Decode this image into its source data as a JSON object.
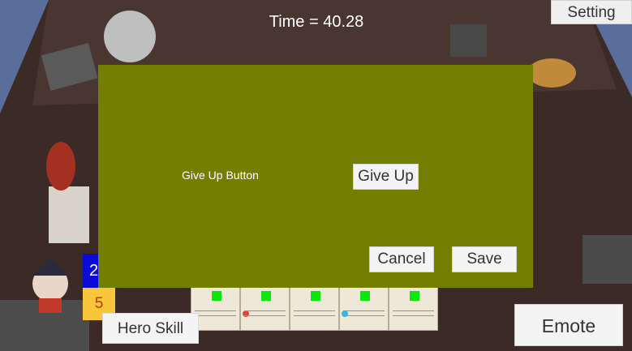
{
  "hud": {
    "timer": "Time = 40.28",
    "setting_label": "Setting",
    "mana_value": "2",
    "health_value": "5",
    "hero_skill_label": "Hero Skill",
    "emote_label": "Emote"
  },
  "dialog": {
    "label": "Give Up Button",
    "give_up_label": "Give Up",
    "cancel_label": "Cancel",
    "save_label": "Save"
  },
  "hand": {
    "cards": [
      {
        "gem_color": "#0be60b",
        "dot_color": null
      },
      {
        "gem_color": "#0be60b",
        "dot_color": "#d9473a"
      },
      {
        "gem_color": "#0be60b",
        "dot_color": null
      },
      {
        "gem_color": "#0be60b",
        "dot_color": "#3cb5d8"
      },
      {
        "gem_color": "#0be60b",
        "dot_color": null
      }
    ]
  },
  "colors": {
    "dialog_bg": "#737f00",
    "mana_badge": "#0b0bd6",
    "health_badge": "#f9c53a"
  }
}
